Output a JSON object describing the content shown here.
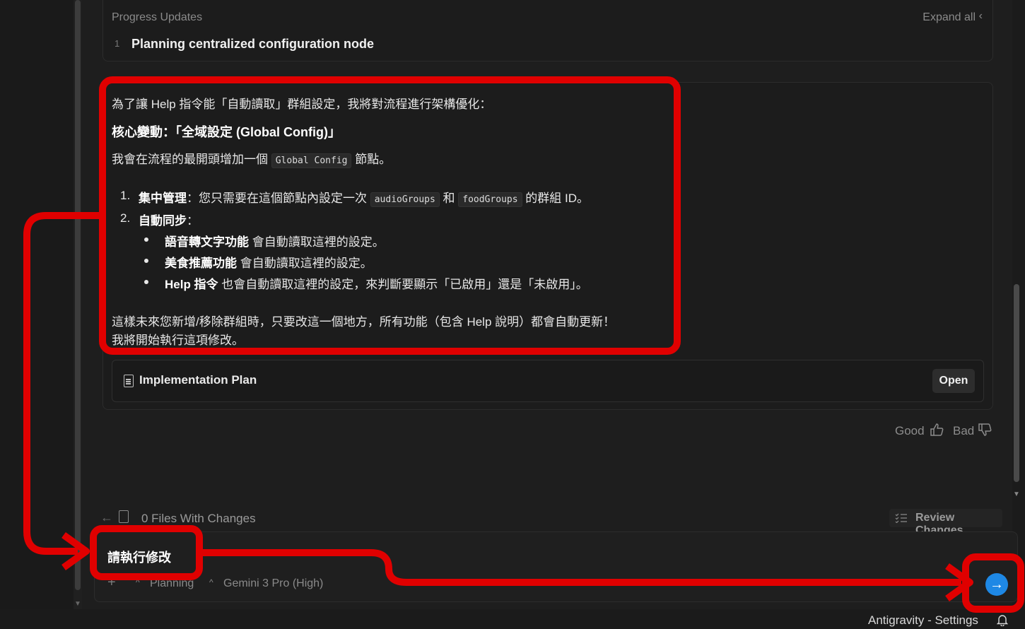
{
  "progress": {
    "title": "Progress Updates",
    "expand_label": "Expand all",
    "steps": [
      {
        "num": "1",
        "text": "Planning centralized configuration node"
      }
    ]
  },
  "message": {
    "intro": "為了讓 Help 指令能「自動讀取」群組設定，我將對流程進行架構優化：",
    "heading": "核心變動：「全域設定 (Global Config)」",
    "line3_before": "我會在流程的最開頭增加一個 ",
    "line3_code": "Global Config",
    "line3_after": " 節點。",
    "item1_num": "1.",
    "item1_bold": "集中管理",
    "item1_text": "：您只需要在這個節點內設定一次 ",
    "item1_code1": "audioGroups",
    "item1_mid": " 和 ",
    "item1_code2": "foodGroups",
    "item1_end": " 的群組 ID。",
    "item2_num": "2.",
    "item2_bold": "自動同步",
    "item2_colon": "：",
    "sub1_bold": "語音轉文字功能",
    "sub1_text": " 會自動讀取這裡的設定。",
    "sub2_bold": "美食推薦功能",
    "sub2_text": " 會自動讀取這裡的設定。",
    "sub3_bold": "Help 指令",
    "sub3_text": " 也會自動讀取這裡的設定，來判斷要顯示「已啟用」還是「未啟用」。",
    "closing1": "這樣未來您新增/移除群組時，只要改這一個地方，所有功能（包含 Help 說明）都會自動更新！",
    "closing2": "我將開始執行這項修改。"
  },
  "artifact": {
    "label": "Implementation Plan",
    "open_label": "Open"
  },
  "feedback": {
    "good": "Good",
    "bad": "Bad"
  },
  "files": {
    "label": "0 Files With Changes",
    "review_label": "Review Changes"
  },
  "input": {
    "value": "請執行修改",
    "mode": "Planning",
    "model": "Gemini 3 Pro (High)"
  },
  "status": {
    "text": "Antigravity - Settings"
  },
  "colors": {
    "accent": "#1e88e5",
    "annotation": "#e00000"
  }
}
